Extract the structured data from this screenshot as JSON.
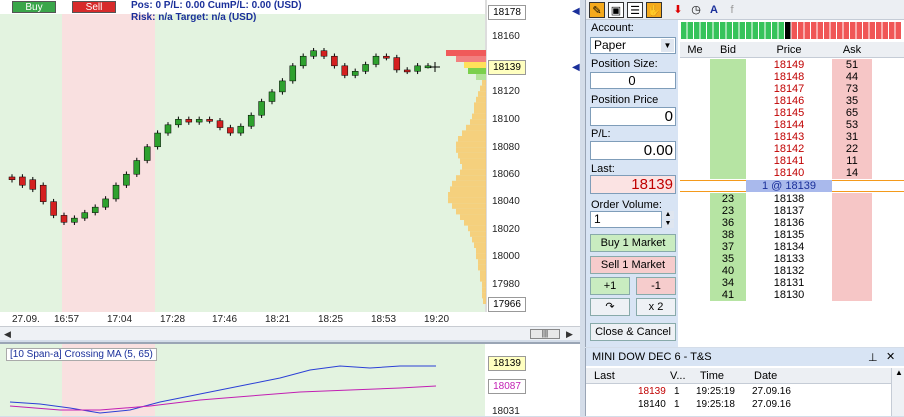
{
  "chart": {
    "buy_label": "Buy",
    "sell_label": "Sell",
    "position_line": "Pos: 0  P/L: 0.00  CumP/L: 0.00 (USD)",
    "risk_line": "Risk: n/a  Target: n/a (USD)",
    "price_ticks": [
      "18160",
      "18120",
      "18100",
      "18080",
      "18060",
      "18040",
      "18020",
      "18000",
      "17980"
    ],
    "top_price": "18178",
    "last_price_box": "18139",
    "bottom_price": "17966",
    "time_labels": [
      "27.09.",
      "16:57",
      "17:04",
      "17:28",
      "17:46",
      "18:21",
      "18:25",
      "18:53",
      "19:20"
    ],
    "scroll_thumb": "|||"
  },
  "indicator": {
    "title": "[10 Span-a] Crossing MA  (5, 65)",
    "value_1": "18139",
    "value_2": "18087",
    "bottom_value": "18031"
  },
  "dom": {
    "account_label": "Account:",
    "account_value": "Paper",
    "position_size_label": "Position Size:",
    "position_size_value": "0",
    "position_price_label": "Position Price",
    "position_price_value": "0",
    "pl_label": "P/L:",
    "pl_value": "0.00",
    "last_label": "Last:",
    "last_value": "18139",
    "order_volume_label": "Order Volume:",
    "order_volume_value": "1",
    "buy_market_label": "Buy 1 Market",
    "sell_market_label": "Sell 1 Market",
    "plus_one_label": "+1",
    "minus_one_label": "-1",
    "reverse_icon": "↷",
    "x2_label": "x 2",
    "close_cancel_label": "Close & Cancel",
    "col_me": "Me",
    "col_bid": "Bid",
    "col_price": "Price",
    "col_ask": "Ask",
    "asks": [
      {
        "price": "18149",
        "ask": "51"
      },
      {
        "price": "18148",
        "ask": "44"
      },
      {
        "price": "18147",
        "ask": "73"
      },
      {
        "price": "18146",
        "ask": "35"
      },
      {
        "price": "18145",
        "ask": "65"
      },
      {
        "price": "18144",
        "ask": "53"
      },
      {
        "price": "18143",
        "ask": "31"
      },
      {
        "price": "18142",
        "ask": "22"
      },
      {
        "price": "18141",
        "ask": "11"
      },
      {
        "price": "18140",
        "ask": "14"
      }
    ],
    "last_row": "1 @ 18139",
    "bids": [
      {
        "bid": "23",
        "price": "18138"
      },
      {
        "bid": "23",
        "price": "18137"
      },
      {
        "bid": "36",
        "price": "18136"
      },
      {
        "bid": "38",
        "price": "18135"
      },
      {
        "bid": "37",
        "price": "18134"
      },
      {
        "bid": "35",
        "price": "18133"
      },
      {
        "bid": "40",
        "price": "18132"
      },
      {
        "bid": "34",
        "price": "18131"
      },
      {
        "bid": "41",
        "price": "18130"
      }
    ]
  },
  "ts": {
    "title": "MINI DOW DEC 6 - T&S",
    "col_last": "Last",
    "col_v": "V...",
    "col_time": "Time",
    "col_date": "Date",
    "rows": [
      {
        "last": "18139",
        "v": "1",
        "time": "19:25:19",
        "date": "27.09.16",
        "color": "#c00000"
      },
      {
        "last": "18140",
        "v": "1",
        "time": "19:25:18",
        "date": "27.09.16",
        "color": "#000000"
      }
    ]
  },
  "colors": {
    "buy": "#3aa64a",
    "sell": "#d72b2b",
    "candle_up": "#2ea12e",
    "candle_down": "#d42020",
    "bid_bg": "#b6e4a3",
    "ask_bg": "#f6c6c6",
    "last_row_bg": "#a9b9ec"
  }
}
